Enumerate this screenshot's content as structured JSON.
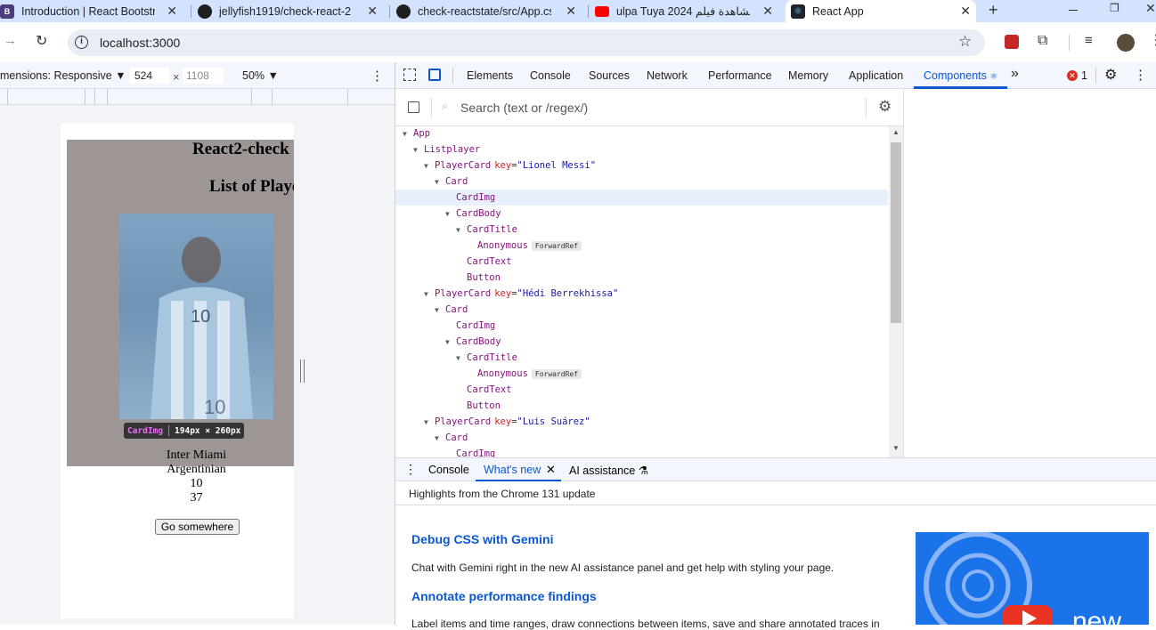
{
  "tabs": [
    {
      "title": "Introduction | React Bootstrap"
    },
    {
      "title": "jellyfish1919/check-react-2"
    },
    {
      "title": "check-reactstate/src/App.css"
    },
    {
      "title": "ulpa Tuya 2024 مشاهدة فيلم"
    },
    {
      "title": "React App"
    }
  ],
  "address": {
    "url": "localhost:3000"
  },
  "device_toolbar": {
    "dimensions": "mensions: Responsive",
    "width": "524",
    "times": "×",
    "height_placeholder": "1108",
    "zoom": "50%"
  },
  "page": {
    "heading": "React2-check",
    "subheading": "List of Players",
    "card_tooltip": {
      "name": "CardImg",
      "size": "194px × 260px"
    },
    "card_text": [
      "Inter Miami",
      "Argentinian",
      "10",
      "37"
    ],
    "button": "Go somewhere"
  },
  "devtools": {
    "tabs": [
      "Elements",
      "Console",
      "Sources",
      "Network",
      "Performance",
      "Memory",
      "Application",
      "Components"
    ],
    "more": "»",
    "error_count": "1",
    "search_placeholder": "Search (text or /regex/)",
    "tree": [
      {
        "name": "App",
        "indent": 0,
        "arrow": true
      },
      {
        "name": "Listplayer",
        "indent": 1,
        "arrow": true
      },
      {
        "name": "PlayerCard",
        "indent": 2,
        "arrow": true,
        "key": "key",
        "value": "\"Lionel Messi\""
      },
      {
        "name": "Card",
        "indent": 3,
        "arrow": true
      },
      {
        "name": "CardImg",
        "indent": 4,
        "arrow": false,
        "selected": true
      },
      {
        "name": "CardBody",
        "indent": 4,
        "arrow": true
      },
      {
        "name": "CardTitle",
        "indent": 5,
        "arrow": true
      },
      {
        "name": "Anonymous",
        "indent": 6,
        "arrow": false,
        "badge": "ForwardRef"
      },
      {
        "name": "CardText",
        "indent": 5,
        "arrow": false
      },
      {
        "name": "Button",
        "indent": 5,
        "arrow": false
      },
      {
        "name": "PlayerCard",
        "indent": 2,
        "arrow": true,
        "key": "key",
        "value": "\"Hédi Berrekhissa\""
      },
      {
        "name": "Card",
        "indent": 3,
        "arrow": true
      },
      {
        "name": "CardImg",
        "indent": 4,
        "arrow": false
      },
      {
        "name": "CardBody",
        "indent": 4,
        "arrow": true
      },
      {
        "name": "CardTitle",
        "indent": 5,
        "arrow": true
      },
      {
        "name": "Anonymous",
        "indent": 6,
        "arrow": false,
        "badge": "ForwardRef"
      },
      {
        "name": "CardText",
        "indent": 5,
        "arrow": false
      },
      {
        "name": "Button",
        "indent": 5,
        "arrow": false
      },
      {
        "name": "PlayerCard",
        "indent": 2,
        "arrow": true,
        "key": "key",
        "value": "\"Luis Suárez\""
      },
      {
        "name": "Card",
        "indent": 3,
        "arrow": true
      },
      {
        "name": "CardImg",
        "indent": 4,
        "arrow": false
      }
    ],
    "drawer_tabs": [
      "Console",
      "What's new",
      "AI assistance"
    ],
    "whatsnew": {
      "banner": "Highlights from the Chrome 131 update",
      "h1": "Debug CSS with Gemini",
      "p1": "Chat with Gemini right in the new AI assistance panel and get help with styling your page.",
      "h2": "Annotate performance findings",
      "p2": "Label items and time ranges, draw connections between items, save and share annotated traces in",
      "promo_text": "new"
    }
  },
  "colors": {
    "accent": "#0b57d0",
    "tabstrip": "#d3e3fd",
    "page_bg": "#9e9694",
    "selected_row": "#e8f0fe"
  }
}
